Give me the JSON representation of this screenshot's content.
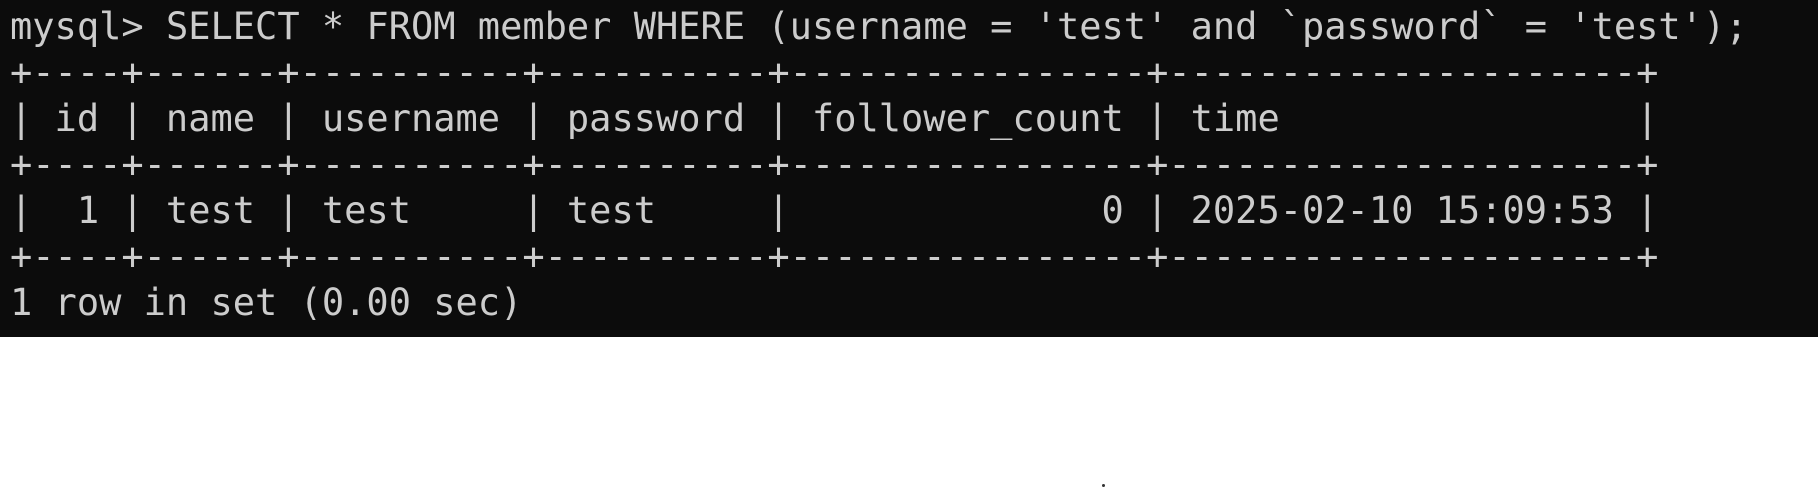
{
  "terminal": {
    "prompt": "mysql> ",
    "command": "SELECT * FROM member WHERE (username = 'test' and `password` = 'test');",
    "table": {
      "border": "+----+------+----------+----------+----------------+---------------------+",
      "columns": [
        "id",
        "name",
        "username",
        "password",
        "follower_count",
        "time"
      ],
      "header_line": "| id | name | username | password | follower_count | time                |",
      "rows": [
        {
          "id": "1",
          "name": "test",
          "username": "test",
          "password": "test",
          "follower_count": "0",
          "time": "2025-02-10 15:09:53",
          "line": "|  1 | test | test     | test     |              0 | 2025-02-10 15:09:53 |"
        }
      ]
    },
    "result_summary": "1 row in set (0.00 sec)"
  },
  "colors": {
    "terminal_background": "#0c0c0c",
    "terminal_text": "#cccccc",
    "page_background": "#ffffff"
  }
}
